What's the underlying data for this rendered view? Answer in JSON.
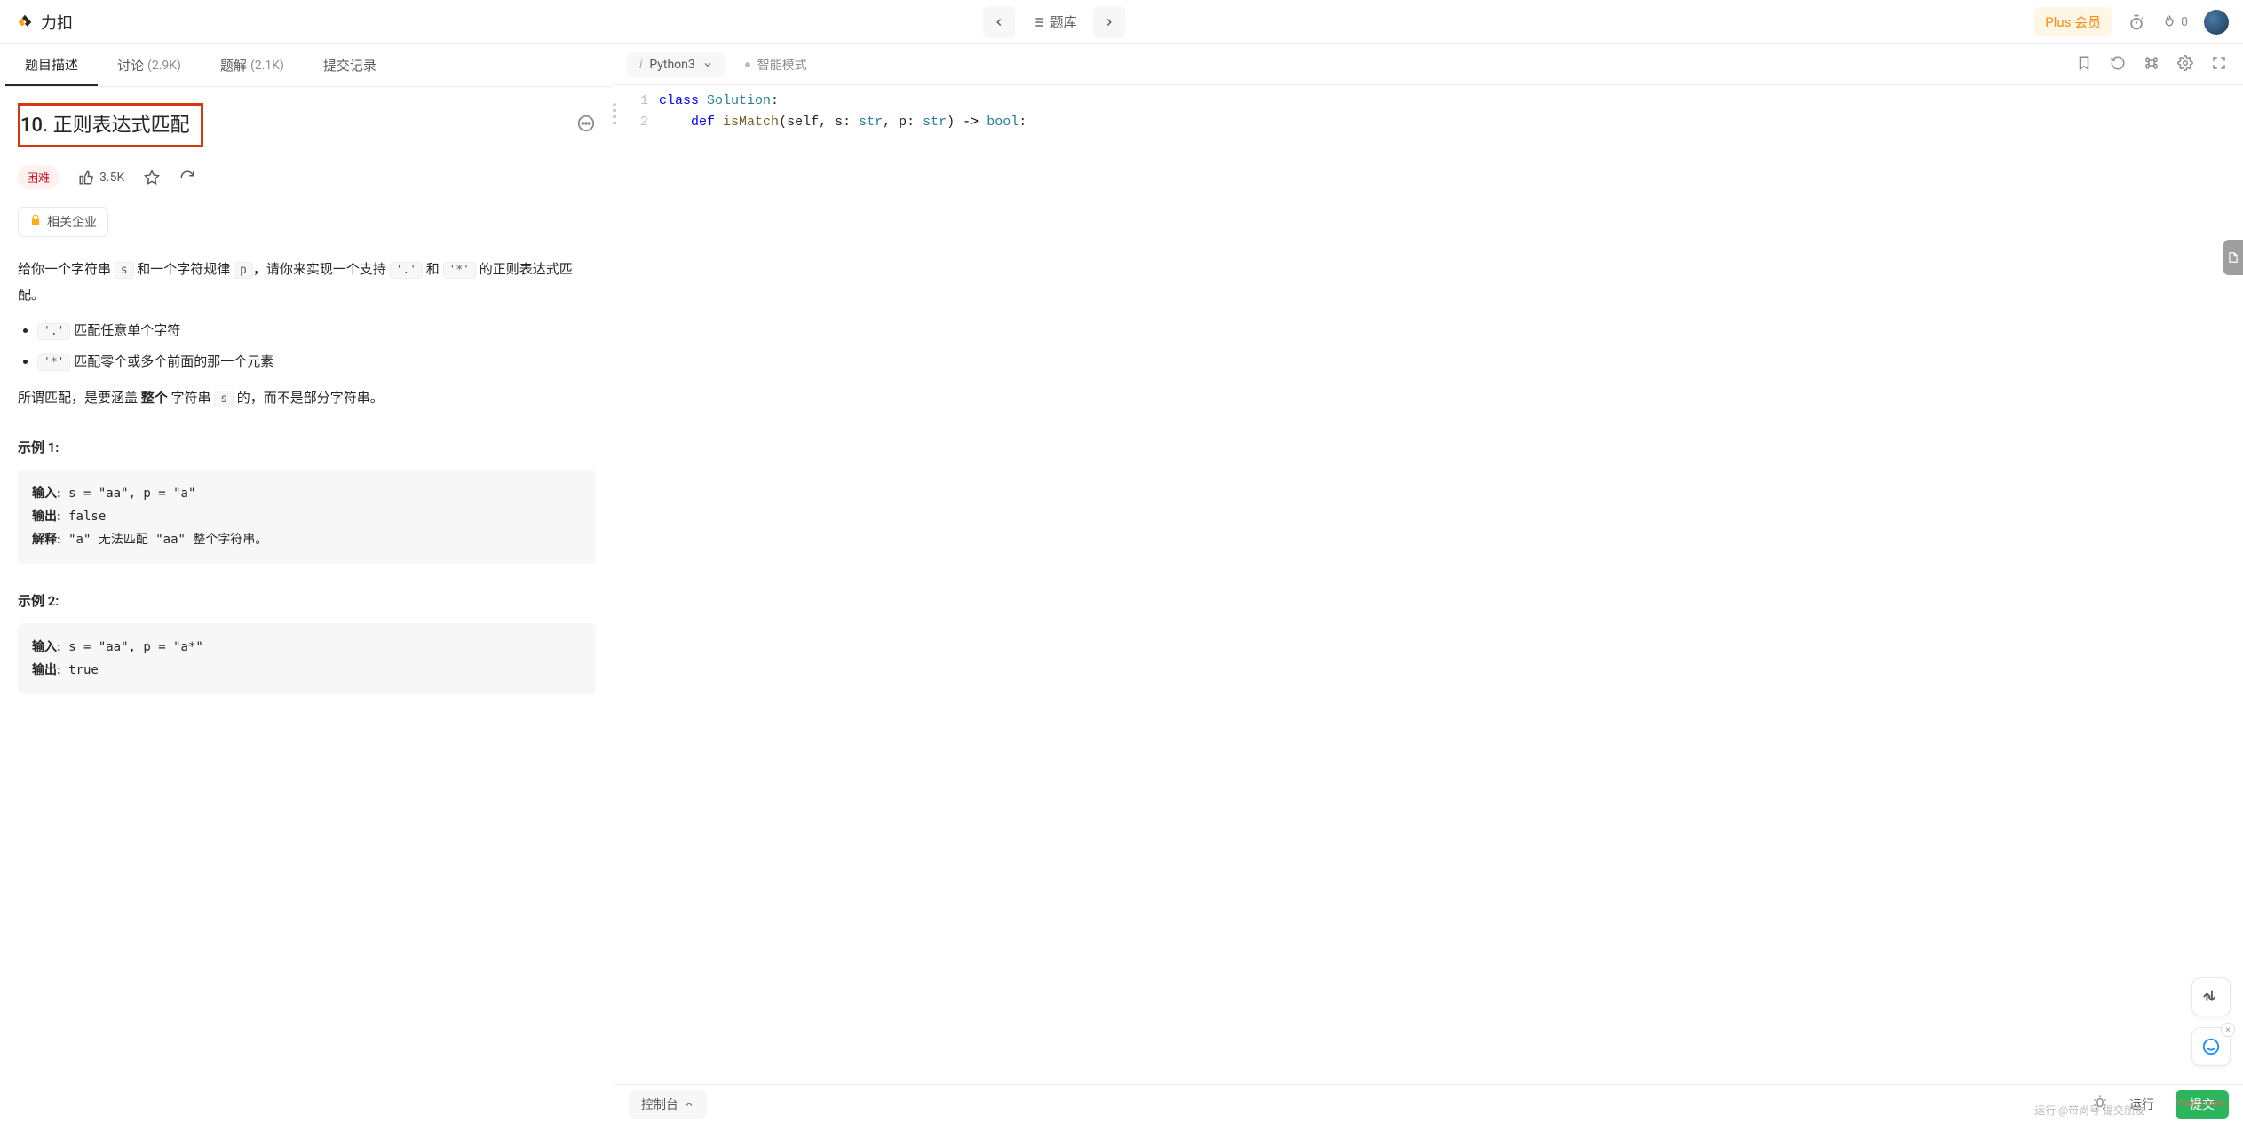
{
  "topbar": {
    "brand": "力扣",
    "problem_list": "题库",
    "plus_label": "Plus 会员",
    "streak": "0"
  },
  "tabs": [
    {
      "label": "题目描述",
      "count": "",
      "active": true
    },
    {
      "label": "讨论",
      "count": "(2.9K)",
      "active": false
    },
    {
      "label": "题解",
      "count": "(2.1K)",
      "active": false
    },
    {
      "label": "提交记录",
      "count": "",
      "active": false
    }
  ],
  "problem": {
    "number": "10.",
    "title": "正则表达式匹配",
    "difficulty": "困难",
    "likes": "3.5K",
    "companies_label": "相关企业",
    "desc_prefix": "给你一个字符串 ",
    "desc_s": "s",
    "desc_mid1": " 和一个字符规律 ",
    "desc_p": "p",
    "desc_mid2": "，请你来实现一个支持 ",
    "desc_dot": "'.'",
    "desc_mid3": " 和 ",
    "desc_star": "'*'",
    "desc_suffix": " 的正则表达式匹配。",
    "bullet1_code": "'.'",
    "bullet1_text": " 匹配任意单个字符",
    "bullet2_code": "'*'",
    "bullet2_text": " 匹配零个或多个前面的那一个元素",
    "cover_p1": "所谓匹配，是要涵盖 ",
    "cover_bold": "整个 ",
    "cover_p2": "字符串 ",
    "cover_s": "s",
    "cover_p3": " 的，而不是部分字符串。",
    "example1_h": "示例 1:",
    "example1_input_label": "输入:",
    "example1_input": " s = \"aa\", p = \"a\"",
    "example1_output_label": "输出:",
    "example1_output": " false",
    "example1_explain_label": "解释:",
    "example1_explain": " \"a\"  无法匹配 \"aa\"  整个字符串。",
    "example2_h": "示例 2:",
    "example2_input_label": "输入:",
    "example2_input": " s = \"aa\", p = \"a*\"",
    "example2_output_label": "输出:",
    "example2_output": " true"
  },
  "editor": {
    "language": "Python3",
    "mode": "智能模式",
    "lines": [
      {
        "n": 1,
        "html": "<span class='tok-kw'>class</span> <span class='tok-cls'>Solution</span>:"
      },
      {
        "n": 2,
        "html": "    <span class='tok-kw'>def</span> <span class='tok-fn'>isMatch</span>(<span>self</span>, s: <span class='tok-type'>str</span>, p: <span class='tok-type'>str</span>) <span class='tok-op'>-&gt;</span> <span class='tok-type'>bool</span>:"
      }
    ]
  },
  "bottom": {
    "console": "控制台",
    "run": "运行",
    "submit": "提交"
  },
  "watermark": "运行 @带尚号 提交朋友",
  "wm2": "Yuucn.com"
}
